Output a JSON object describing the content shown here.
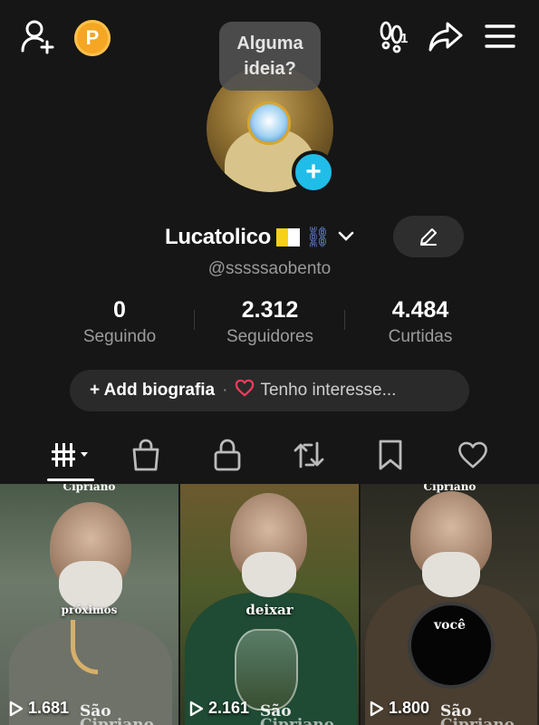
{
  "topbar": {
    "add_friend_icon": "add-user-icon",
    "coin_letter": "P",
    "friends_icon": "footprints-icon",
    "friends_count": "1",
    "share_icon": "share-arrow-icon",
    "menu_icon": "hamburger-menu-icon"
  },
  "avatar": {
    "tooltip": "Alguma ideia?",
    "add_badge": "+"
  },
  "profile": {
    "username": "Lucatolico",
    "handle": "@sssssaobento",
    "edit_icon": "pencil-icon"
  },
  "stats": [
    {
      "value": "0",
      "label": "Seguindo"
    },
    {
      "value": "2.312",
      "label": "Seguidores"
    },
    {
      "value": "4.484",
      "label": "Curtidas"
    }
  ],
  "bio": {
    "add_label": "+ Add biografia",
    "separator": "·",
    "interest_label": "Tenho interesse..."
  },
  "tabs": [
    {
      "name": "videos",
      "icon": "grid-bars-icon"
    },
    {
      "name": "shop",
      "icon": "shopping-bag-icon"
    },
    {
      "name": "private",
      "icon": "lock-icon"
    },
    {
      "name": "reposts",
      "icon": "repost-icon"
    },
    {
      "name": "favorites",
      "icon": "bookmark-icon"
    },
    {
      "name": "liked",
      "icon": "heart-icon"
    }
  ],
  "videos": [
    {
      "top_caption": "Cipriano",
      "overlay": "próximos",
      "views": "1.681",
      "subtitle": "São",
      "subtitle2": "Cipriano"
    },
    {
      "top_caption": "",
      "overlay": "deixar",
      "views": "2.161",
      "subtitle": "São",
      "subtitle2": "Cipriano"
    },
    {
      "top_caption": "Cipriano",
      "overlay": "você",
      "views": "1.800",
      "subtitle": "São",
      "subtitle2": "Cipriano"
    }
  ],
  "colors": {
    "background": "#161616",
    "accent_blue": "#20bde8",
    "coin": "#f5a623",
    "heart": "#ff3b5c"
  }
}
